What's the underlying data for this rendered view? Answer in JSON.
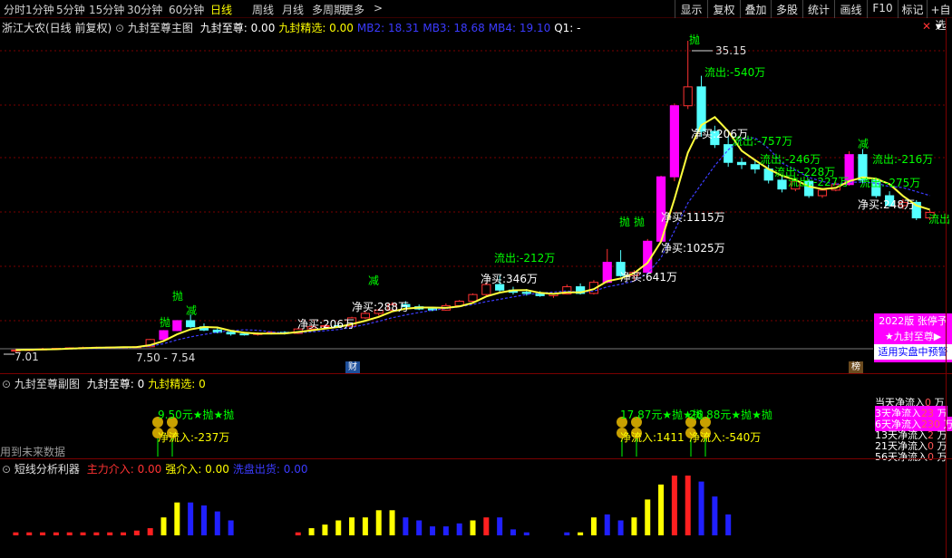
{
  "toolbar": {
    "periods": [
      "分时",
      "1分钟",
      "5分钟",
      "15分钟",
      "30分钟",
      "60分钟",
      "日线",
      "周线",
      "月线",
      "多周期",
      "更多"
    ],
    "more_arrow": ">",
    "active_period": "日线",
    "right_buttons": [
      "显示",
      "复权",
      "叠加",
      "多股",
      "统计",
      "画线",
      "F10",
      "标记",
      "+自选"
    ]
  },
  "main_panel": {
    "stock_name": "浙江大农(日线 前复权)",
    "indicator_name": "九封至尊主图",
    "params": [
      {
        "label": "九封至尊: 0.00",
        "color": "#ffffff"
      },
      {
        "label": "九封精选: 0.00",
        "color": "#ffff00"
      },
      {
        "label": "MB2: 18.31",
        "color": "#3b3bff"
      },
      {
        "label": "MB3: 18.68",
        "color": "#3b3bff"
      },
      {
        "label": "MB4: 19.10",
        "color": "#3b3bff"
      },
      {
        "label": "Q1: -",
        "color": "#ffffff"
      }
    ],
    "high_price": "35.15",
    "low_price": "7.01",
    "range_label": "7.50 - 7.54",
    "annotations": [
      {
        "text": "抛",
        "color": "#00ff00"
      },
      {
        "text": "抛",
        "color": "#00ff00"
      },
      {
        "text": "减",
        "color": "#00ff00"
      },
      {
        "text": "减",
        "color": "#00ff00"
      },
      {
        "text": "抛",
        "color": "#00ff00"
      },
      {
        "text": "抛",
        "color": "#00ff00"
      },
      {
        "text": "抛",
        "color": "#00ff00"
      },
      {
        "text": "减",
        "color": "#00ff00"
      },
      {
        "text": "流出:-540万",
        "color": "#00ff00"
      },
      {
        "text": "流出:-757万",
        "color": "#00ff00"
      },
      {
        "text": "流出:-246万",
        "color": "#00ff00"
      },
      {
        "text": "流出:-228万",
        "color": "#00ff00"
      },
      {
        "text": "流出:-227万",
        "color": "#00ff00"
      },
      {
        "text": "流出:-216万",
        "color": "#00ff00"
      },
      {
        "text": "流出:-275万",
        "color": "#00ff00"
      },
      {
        "text": "流出:-212万",
        "color": "#00ff00"
      },
      {
        "text": "流出",
        "color": "#00ff00"
      },
      {
        "text": "净买:206万",
        "color": "#ffffff"
      },
      {
        "text": "净买:288万",
        "color": "#ffffff"
      },
      {
        "text": "净买:346万",
        "color": "#ffffff"
      },
      {
        "text": "净买:641万",
        "color": "#ffffff"
      },
      {
        "text": "净买:1025万",
        "color": "#ffffff"
      },
      {
        "text": "净买:1115万",
        "color": "#ffffff"
      },
      {
        "text": "净买:206万",
        "color": "#ffffff"
      },
      {
        "text": "净买:248万",
        "color": "#ffffff"
      }
    ],
    "markers": [
      "财",
      "榜"
    ],
    "ad_box": {
      "line1": "2022版 张停予",
      "line2": "★九封至尊▶",
      "line3": "适用实盘中预警"
    }
  },
  "sub_panel": {
    "title": "九封至尊副图",
    "params": [
      {
        "label": "九封至尊: 0",
        "color": "#ffffff"
      },
      {
        "label": "九封精选: 0",
        "color": "#ffff00"
      }
    ],
    "footer": "用到未来数据",
    "signals_left": [
      {
        "text": "9.50元★抛★抛",
        "color": "#00ff00"
      },
      {
        "text": "净流入:-237万",
        "color": "#ffff00"
      }
    ],
    "signals_right": [
      {
        "text": "17.87元★抛★抛",
        "color": "#00ff00"
      },
      {
        "text": "净流入:1411",
        "color": "#ffff00"
      },
      {
        "text": "26.88元★抛★抛",
        "color": "#00ff00"
      },
      {
        "text": "净流入:-540万",
        "color": "#ffff00"
      }
    ],
    "stats": [
      {
        "label": "当天净流入",
        "value": "0",
        "unit": "万",
        "highlight": false
      },
      {
        "label": "3天净流入",
        "value": "23",
        "unit": "万",
        "highlight": true
      },
      {
        "label": "6天净流入",
        "value": "230",
        "unit": "万",
        "highlight": true
      },
      {
        "label": "13天净流入",
        "value": "2",
        "unit": "万",
        "highlight": false
      },
      {
        "label": "21天净流入",
        "value": "0",
        "unit": "万",
        "highlight": false
      },
      {
        "label": "56天净流入",
        "value": "0",
        "unit": "万",
        "highlight": false
      }
    ]
  },
  "bottom_panel": {
    "title": "短线分析利器",
    "params": [
      {
        "label": "主力介入: 0.00",
        "color": "#ff3333"
      },
      {
        "label": "强介入: 0.00",
        "color": "#ffff00"
      },
      {
        "label": "洗盘出货: 0.00",
        "color": "#3b3bff"
      }
    ]
  },
  "colors": {
    "up": "#ff3232",
    "down": "#54ffff",
    "limit": "#ff00ff",
    "ma": "#ffff3c",
    "mb": "#3c3cff",
    "signal": "#00ff00",
    "grid": "#7a0000"
  },
  "chart_data": {
    "type": "candlestick",
    "y_range": [
      7.01,
      35.15
    ],
    "candles": [
      [
        7.2,
        7.4,
        7.1,
        7.3
      ],
      [
        7.3,
        7.4,
        7.2,
        7.35
      ],
      [
        7.35,
        7.5,
        7.3,
        7.4
      ],
      [
        7.4,
        7.5,
        7.3,
        7.45
      ],
      [
        7.45,
        7.55,
        7.4,
        7.5
      ],
      [
        7.5,
        7.6,
        7.4,
        7.52
      ],
      [
        7.52,
        7.6,
        7.45,
        7.55
      ],
      [
        7.55,
        7.6,
        7.5,
        7.56
      ],
      [
        7.56,
        7.6,
        7.5,
        7.58
      ],
      [
        7.58,
        7.65,
        7.5,
        7.6
      ],
      [
        7.6,
        8.3,
        7.55,
        8.25
      ],
      [
        8.25,
        9.1,
        8.2,
        9.05
      ],
      [
        9.05,
        10.0,
        9.0,
        9.95
      ],
      [
        9.95,
        10.5,
        9.3,
        9.4
      ],
      [
        9.4,
        9.7,
        9.0,
        9.1
      ],
      [
        9.1,
        9.3,
        8.8,
        8.9
      ],
      [
        8.9,
        9.0,
        8.6,
        8.75
      ],
      [
        8.75,
        8.9,
        8.6,
        8.7
      ],
      [
        8.7,
        8.9,
        8.6,
        8.8
      ],
      [
        8.8,
        9.0,
        8.7,
        8.9
      ],
      [
        8.9,
        9.0,
        8.7,
        8.8
      ],
      [
        8.8,
        9.3,
        8.75,
        9.2
      ],
      [
        9.2,
        9.5,
        9.1,
        9.4
      ],
      [
        9.4,
        9.6,
        9.2,
        9.5
      ],
      [
        9.5,
        9.7,
        9.3,
        9.45
      ],
      [
        9.45,
        10.3,
        9.4,
        10.2
      ],
      [
        10.2,
        10.8,
        10.1,
        10.6
      ],
      [
        10.6,
        11.0,
        10.4,
        10.9
      ],
      [
        10.9,
        11.6,
        10.8,
        11.4
      ],
      [
        11.4,
        11.7,
        11.0,
        11.2
      ],
      [
        11.2,
        11.4,
        10.9,
        11.0
      ],
      [
        11.0,
        11.2,
        10.8,
        10.9
      ],
      [
        10.9,
        11.5,
        10.85,
        11.3
      ],
      [
        11.3,
        11.8,
        11.2,
        11.7
      ],
      [
        11.7,
        12.4,
        11.6,
        12.3
      ],
      [
        12.3,
        13.4,
        12.2,
        13.2
      ],
      [
        13.2,
        14.0,
        12.5,
        12.7
      ],
      [
        12.7,
        13.0,
        12.3,
        12.5
      ],
      [
        12.5,
        12.8,
        12.2,
        12.4
      ],
      [
        12.4,
        12.6,
        12.1,
        12.2
      ],
      [
        12.2,
        12.4,
        12.0,
        12.35
      ],
      [
        12.35,
        13.2,
        12.3,
        13.0
      ],
      [
        13.0,
        13.3,
        12.3,
        12.4
      ],
      [
        12.4,
        13.6,
        12.3,
        13.4
      ],
      [
        13.4,
        16.4,
        13.3,
        15.2
      ],
      [
        15.2,
        16.3,
        13.9,
        14.0
      ],
      [
        14.0,
        14.5,
        13.5,
        14.3
      ],
      [
        14.3,
        17.3,
        14.2,
        17.1
      ],
      [
        17.1,
        23.0,
        17.0,
        22.9
      ],
      [
        22.9,
        29.5,
        22.5,
        29.3
      ],
      [
        29.3,
        35.15,
        29.0,
        31.0
      ],
      [
        31.0,
        32.0,
        26.5,
        27.0
      ],
      [
        27.0,
        27.5,
        25.5,
        25.8
      ],
      [
        25.8,
        26.5,
        23.8,
        24.2
      ],
      [
        24.2,
        24.6,
        23.6,
        24.0
      ],
      [
        24.0,
        24.5,
        23.2,
        23.6
      ],
      [
        23.6,
        24.0,
        22.3,
        22.6
      ],
      [
        22.6,
        23.0,
        21.5,
        21.8
      ],
      [
        21.8,
        22.7,
        21.6,
        22.5
      ],
      [
        22.5,
        22.7,
        21.0,
        21.2
      ],
      [
        21.2,
        21.9,
        21.0,
        21.7
      ],
      [
        21.7,
        22.4,
        21.6,
        22.2
      ],
      [
        22.2,
        25.2,
        22.1,
        24.9
      ],
      [
        24.9,
        25.4,
        22.3,
        22.6
      ],
      [
        22.6,
        22.8,
        21.0,
        21.2
      ],
      [
        21.2,
        21.6,
        20.2,
        20.3
      ],
      [
        20.3,
        20.9,
        20.0,
        20.6
      ],
      [
        20.6,
        20.8,
        19.0,
        19.2
      ],
      [
        19.2,
        19.9,
        19.0,
        19.7
      ]
    ],
    "bottom_bars": [
      {
        "v": 0.05,
        "c": "r"
      },
      {
        "v": 0.05,
        "c": "r"
      },
      {
        "v": 0.05,
        "c": "r"
      },
      {
        "v": 0.05,
        "c": "r"
      },
      {
        "v": 0.05,
        "c": "r"
      },
      {
        "v": 0.05,
        "c": "r"
      },
      {
        "v": 0.05,
        "c": "r"
      },
      {
        "v": 0.05,
        "c": "r"
      },
      {
        "v": 0.05,
        "c": "r"
      },
      {
        "v": 0.08,
        "c": "r"
      },
      {
        "v": 0.12,
        "c": "r"
      },
      {
        "v": 0.3,
        "c": "y"
      },
      {
        "v": 0.55,
        "c": "y"
      },
      {
        "v": 0.55,
        "c": "b"
      },
      {
        "v": 0.5,
        "c": "b"
      },
      {
        "v": 0.4,
        "c": "b"
      },
      {
        "v": 0.25,
        "c": "b"
      },
      {
        "v": 0.0,
        "c": "b"
      },
      {
        "v": 0.0,
        "c": "b"
      },
      {
        "v": 0.0,
        "c": "b"
      },
      {
        "v": 0.0,
        "c": "b"
      },
      {
        "v": 0.05,
        "c": "r"
      },
      {
        "v": 0.12,
        "c": "y"
      },
      {
        "v": 0.18,
        "c": "y"
      },
      {
        "v": 0.25,
        "c": "y"
      },
      {
        "v": 0.3,
        "c": "y"
      },
      {
        "v": 0.3,
        "c": "y"
      },
      {
        "v": 0.42,
        "c": "y"
      },
      {
        "v": 0.42,
        "c": "y"
      },
      {
        "v": 0.3,
        "c": "b"
      },
      {
        "v": 0.25,
        "c": "b"
      },
      {
        "v": 0.15,
        "c": "b"
      },
      {
        "v": 0.15,
        "c": "b"
      },
      {
        "v": 0.2,
        "c": "b"
      },
      {
        "v": 0.25,
        "c": "y"
      },
      {
        "v": 0.3,
        "c": "r"
      },
      {
        "v": 0.3,
        "c": "b"
      },
      {
        "v": 0.1,
        "c": "b"
      },
      {
        "v": 0.05,
        "c": "b"
      },
      {
        "v": 0.0,
        "c": "b"
      },
      {
        "v": 0.0,
        "c": "b"
      },
      {
        "v": 0.05,
        "c": "b"
      },
      {
        "v": 0.05,
        "c": "y"
      },
      {
        "v": 0.3,
        "c": "y"
      },
      {
        "v": 0.35,
        "c": "b"
      },
      {
        "v": 0.25,
        "c": "b"
      },
      {
        "v": 0.3,
        "c": "y"
      },
      {
        "v": 0.6,
        "c": "y"
      },
      {
        "v": 0.85,
        "c": "y"
      },
      {
        "v": 1.0,
        "c": "r"
      },
      {
        "v": 1.0,
        "c": "r"
      },
      {
        "v": 0.9,
        "c": "b"
      },
      {
        "v": 0.65,
        "c": "b"
      },
      {
        "v": 0.35,
        "c": "b"
      },
      {
        "v": 0.0,
        "c": "b"
      },
      {
        "v": 0.0,
        "c": "b"
      },
      {
        "v": 0.0,
        "c": "b"
      },
      {
        "v": 0.0,
        "c": "b"
      },
      {
        "v": 0.0,
        "c": "b"
      },
      {
        "v": 0.0,
        "c": "b"
      },
      {
        "v": 0.0,
        "c": "b"
      },
      {
        "v": 0.0,
        "c": "b"
      },
      {
        "v": 0.0,
        "c": "b"
      },
      {
        "v": 0.0,
        "c": "b"
      },
      {
        "v": 0.0,
        "c": "b"
      },
      {
        "v": 0.0,
        "c": "b"
      },
      {
        "v": 0.0,
        "c": "b"
      },
      {
        "v": 0.0,
        "c": "b"
      },
      {
        "v": 0.0,
        "c": "b"
      }
    ]
  }
}
